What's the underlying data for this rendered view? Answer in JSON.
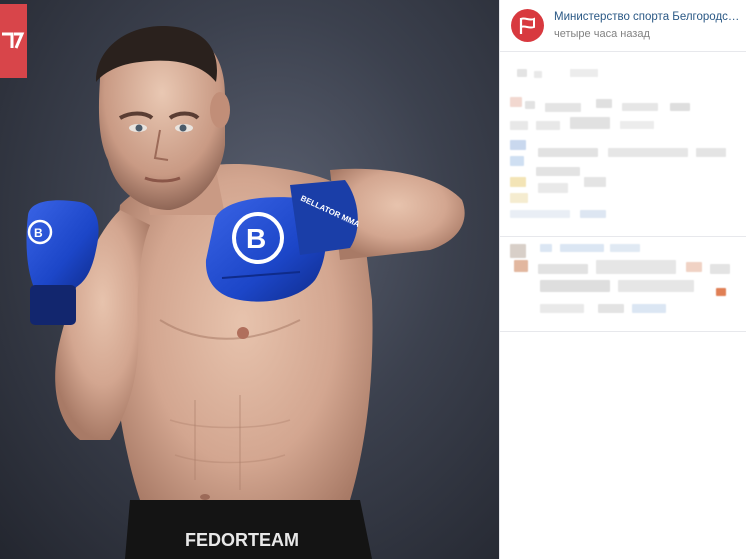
{
  "post": {
    "author": "Министерство спорта Белгородской области",
    "time": "четыре часа назад"
  },
  "photo": {
    "shorts_text": "FEDORTEAM",
    "glove_text": "BELLATOR MMA",
    "wrap_text": "BELLATOR"
  },
  "icons": {
    "avatar": "flag-logo-icon",
    "corner": "brand-logo-icon"
  },
  "colors": {
    "link": "#2a5885",
    "meta": "#828282",
    "brand_red": "#d8393f",
    "glove_blue": "#1c46c8"
  }
}
